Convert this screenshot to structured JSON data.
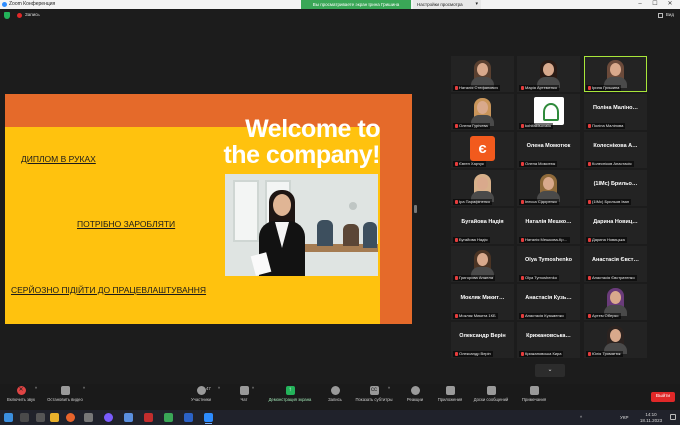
{
  "titlebar": {
    "title": "Zoom Конференция",
    "banner": "Вы просматриваете экран Ірина Гришина",
    "view_options": "Настройки просмотра",
    "minimize": "–",
    "maximize": "☐",
    "close": "✕"
  },
  "recbar": {
    "record_label": "Запись",
    "view_label": "Вид"
  },
  "slide": {
    "headline_line1": "Welcome to",
    "headline_line2": "the company!",
    "items": [
      "ДИПЛОМ В РУКАХ",
      "ПОТРІБНО ЗАРОБЛЯТИ",
      "СЕРЙОЗНО ПІДІЙТИ ДО ПРАЦЕВЛАШТУВАННЯ"
    ]
  },
  "gallery": {
    "tiles": [
      {
        "name": "Наталія Стефанович",
        "big": ""
      },
      {
        "name": "Марія Артеменко",
        "big": ""
      },
      {
        "name": "Ірина Гришина",
        "big": ""
      },
      {
        "name": "Олена Гурічева",
        "big": ""
      },
      {
        "name": "kohifaktsuvaliu",
        "big": ""
      },
      {
        "name": "Поліна Малінова",
        "big": "Поліна  Маліно…"
      },
      {
        "name": "Євген Харчук",
        "big": ""
      },
      {
        "name": "Олена Момотюк",
        "big": "Олена Момотюк"
      },
      {
        "name": "Колесніков Анастасія",
        "big": "Колеснікова  А…"
      },
      {
        "name": "Іра Парафіненко",
        "big": ""
      },
      {
        "name": "Інесса Сідоренко",
        "big": ""
      },
      {
        "name": "(1IMc) Брильов Іван",
        "big": "(1IMc) Брильо…"
      },
      {
        "name": "Бугайова Надія",
        "big": "Бугайова  Надія"
      },
      {
        "name": "Наталія Мешкова-Кр…",
        "big": "Наталія  Мешко…"
      },
      {
        "name": "Дарина Новицька",
        "big": "Дарина  Новиц…"
      },
      {
        "name": "Григорова Анжела",
        "big": ""
      },
      {
        "name": "Olya Tymoshenko",
        "big": "Olya Tymoshenko"
      },
      {
        "name": "Анастасія Євстратенко",
        "big": "Анастасія  Євст…"
      },
      {
        "name": "Мокляк Микита 1КБ",
        "big": "Мокляк  Микит…"
      },
      {
        "name": "Анастасія Кузьменко",
        "big": "Анастасія  Кузь…"
      },
      {
        "name": "Артем Оберко",
        "big": ""
      },
      {
        "name": "Олександр Верін",
        "big": "Олександр Верін"
      },
      {
        "name": "Крижановська Кира",
        "big": "Крижановська…"
      },
      {
        "name": "Юлія Троматюк",
        "big": ""
      }
    ],
    "next": "⌄"
  },
  "toolbar": {
    "mute": "Включить звук",
    "video": "Остановить видео",
    "participants": "Участники",
    "participants_count": "47",
    "chat": "Чат",
    "share": "Демонстрация экрана",
    "record": "Запись",
    "subtitles": "Показать субтитры",
    "reactions": "Реакции",
    "apps": "Приложения",
    "whiteboards": "Доски сообщений",
    "notes": "Примечания",
    "end": "Выйти",
    "caret": "^"
  },
  "taskbar": {
    "lang": "УКР",
    "time": "14:10",
    "date": "18.11.2023",
    "arrow": "^"
  },
  "colors": {
    "slide_orange": "#e56a2a",
    "slide_yellow": "#ffc20e",
    "active_speaker": "#a8e63a",
    "end_red": "#e02828",
    "share_green": "#23b35a"
  }
}
